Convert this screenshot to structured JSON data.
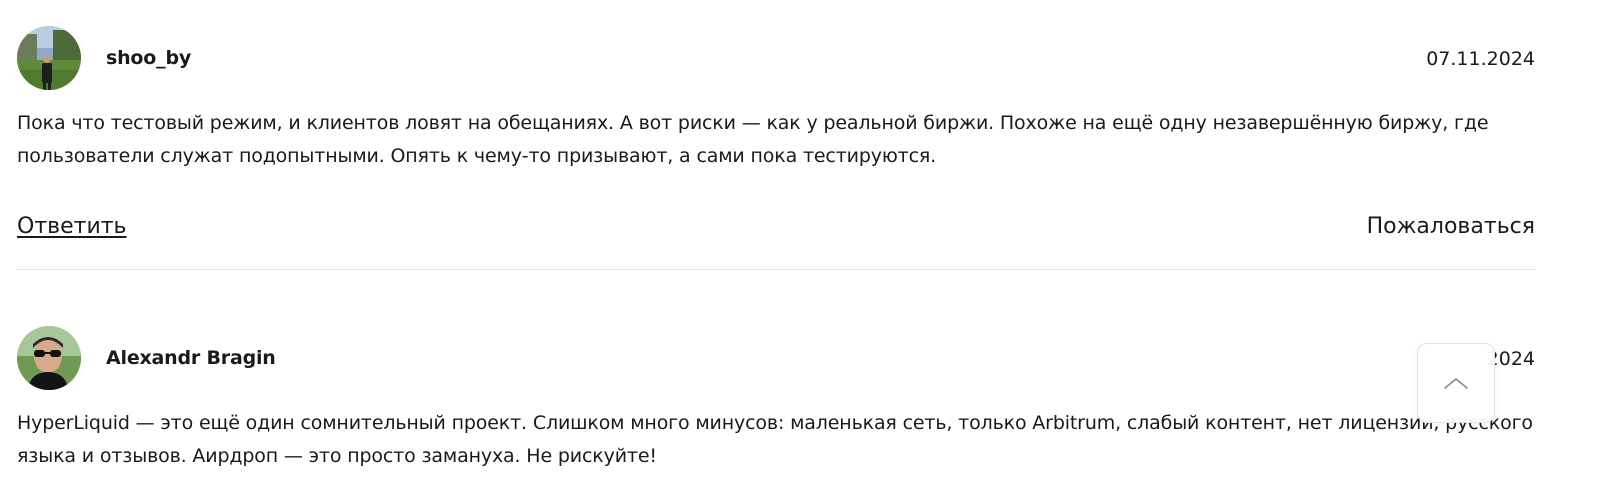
{
  "comments": [
    {
      "author": "shoo_by",
      "date": "07.11.2024",
      "text": "Пока что тестовый режим, и клиентов ловят на обещаниях. А вот риски — как у реальной биржи. Похоже на ещё одну незавершённую биржу, где пользователи служат подопытными. Опять к чему-то призывают, а сами пока тестируются.",
      "reply_label": "Ответить",
      "report_label": "Пожаловаться"
    },
    {
      "author": "Alexandr Bragin",
      "date": "2024",
      "text": "HyperLiquid — это ещё один сомнительный проект. Слишком много минусов: маленькая сеть, только Arbitrum, слабый контент, нет лицензии, русского языка и отзывов. Аирдроп — это просто замануха. Не рискуйте!"
    }
  ],
  "scroll_top_button": {
    "icon": "chevron-up-icon"
  }
}
